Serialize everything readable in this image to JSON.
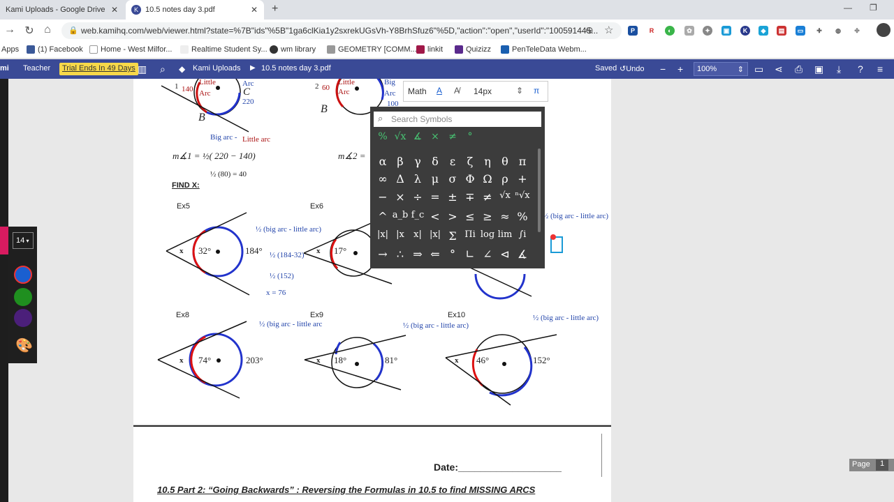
{
  "tabs": [
    {
      "title": "Kami Uploads - Google Drive"
    },
    {
      "title": "10.5 notes day 3.pdf"
    }
  ],
  "address": {
    "url": "web.kamihq.com/web/viewer.html?state=%7B\"ids\"%5B\"1ga6clKia1y2sxrekUGsVh-Y8BrhSfuz6\"%5D,\"action\":\"open\",\"userId\":\"100591445..."
  },
  "bookmarks": [
    "Apps",
    "(1) Facebook",
    "Home - West Milfor...",
    "Realtime Student Sy...",
    "wm library",
    "GEOMETRY [COMM...",
    "linkit",
    "Quizizz",
    "PenTeleData Webm..."
  ],
  "kami": {
    "logo": "mi",
    "teacher": "Teacher",
    "trial": "Trial Ends In 49 Days",
    "breadcrumb_root": "Kami Uploads",
    "breadcrumb_file": "10.5 notes day 3.pdf",
    "saved": "Saved",
    "undo": "Undo",
    "zoom": "100%"
  },
  "stroke_size": "14",
  "colors": {
    "blue": "#1a5fd0",
    "green": "#1f8f1f",
    "purple": "#4b1f7a"
  },
  "math_toolbar": {
    "label": "Math",
    "size": "14px",
    "pi": "π"
  },
  "symbols": {
    "search_placeholder": "Search Symbols",
    "row0": [
      "%",
      "√x",
      "∡",
      "×",
      "≠",
      "°"
    ],
    "row1": [
      "α",
      "β",
      "γ",
      "δ",
      "ε",
      "ζ",
      "η",
      "θ",
      "π"
    ],
    "row2": [
      "∞",
      "Δ",
      "λ",
      "μ",
      "σ",
      "Φ",
      "Ω",
      "ρ",
      "+"
    ],
    "row3": [
      "−",
      "×",
      "÷",
      "=",
      "±",
      "∓",
      "≠",
      "√x",
      "ⁿ√x"
    ],
    "row4": [
      "^",
      "a_b",
      "f_c",
      "<",
      ">",
      "≤",
      "≥",
      "≈",
      "%"
    ],
    "row5": [
      "|x|",
      "|x",
      "x|",
      "|x|",
      "Σ",
      "Πi",
      "log",
      "lim",
      "∫i"
    ],
    "row6": [
      "→",
      "∴",
      "⇒",
      "⇐",
      "°",
      "∟",
      "∠",
      "⊲",
      "∡"
    ]
  },
  "doc": {
    "little_arc_1": "Little",
    "arc_1": "Arc",
    "num_140": "140",
    "big_arc_1": "Arc",
    "c_label": "C",
    "num_220": "220",
    "b_label": "B",
    "num_1": "1",
    "little_arc_2": "Little",
    "arc_2": "Arc",
    "num_2": "2",
    "num_60": "60",
    "big_2": "Big",
    "arc_big2": "Arc",
    "num_100": "100",
    "b_label2": "B",
    "big_arc_minus": "Big arc -",
    "little_arc_lbl": "Little arc",
    "formula_1": "m∡1 = ½( 220 − 140)",
    "formula_1b": "½ (80) = 40",
    "formula_2": "m∡2 = ",
    "find_x": "FIND X:",
    "ex5": "Ex5",
    "ex6": "Ex6",
    "ex8": "Ex8",
    "ex9": "Ex9",
    "ex10": "Ex10",
    "half_big_little": "½ (big arc - little arc)",
    "half_big_little_short": "½ (big arc - little arc",
    "ex5_184": "184°",
    "ex5_32": "32°",
    "ex5_step1": "½ (184-32)",
    "ex5_step2": "½ (152)",
    "ex5_ans": "x = 76",
    "ex6_17": "17°",
    "x": "x",
    "ex8_74": "74°",
    "ex8_203": "203°",
    "ex9_18": "18°",
    "ex9_81": "81°",
    "ex10_46": "46°",
    "ex10_152": "152°",
    "date": "Date:___________________",
    "part2": "10.5 Part 2: “Going Backwards” : Reversing the Formulas in 10.5 to find MISSING ARCS"
  },
  "page_indicator": {
    "label": "Page",
    "num": "1"
  }
}
